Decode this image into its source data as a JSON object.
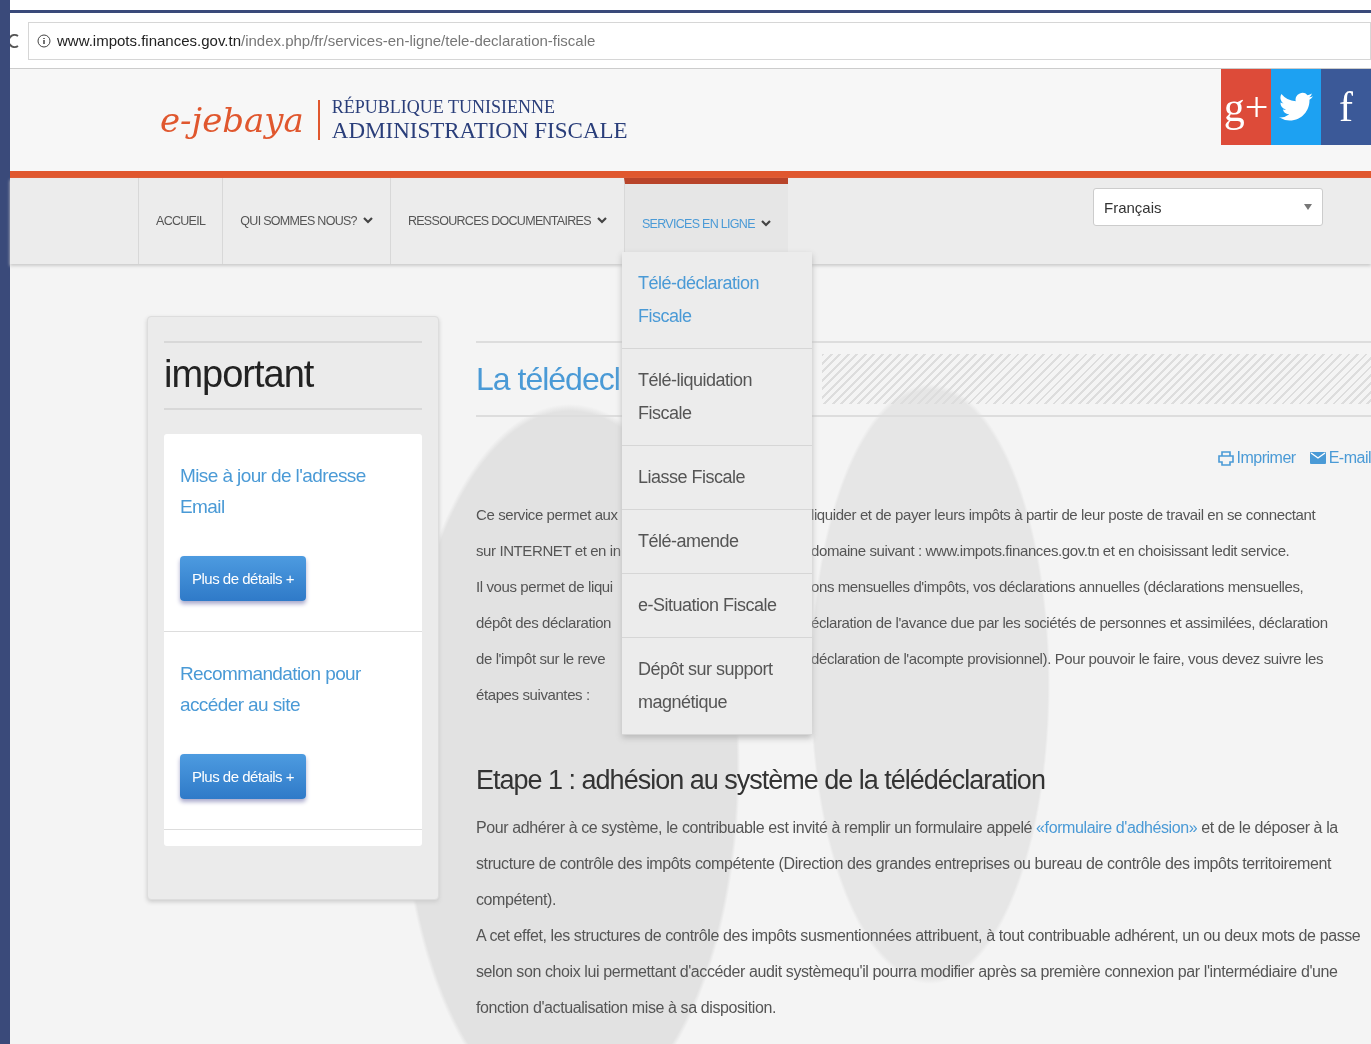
{
  "browser": {
    "url_host": "www.impots.finances.gov.tn",
    "url_path": "/index.php/fr/services-en-ligne/tele-declaration-fiscale"
  },
  "header": {
    "logo_text": "e-jebaya",
    "title_line1": "RÉPUBLIQUE TUNISIENNE",
    "title_line2": "ADMINISTRATION FISCALE"
  },
  "social": [
    {
      "kind": "gplus",
      "glyph": "g+"
    },
    {
      "kind": "twitter"
    },
    {
      "kind": "facebook",
      "glyph": "f"
    }
  ],
  "nav": [
    {
      "label": "ACCUEIL",
      "has_caret": false,
      "selected": false
    },
    {
      "label": "QUI SOMMES NOUS?",
      "has_caret": true,
      "selected": false
    },
    {
      "label": "RESSOURCES DOCUMENTAIRES",
      "has_caret": true,
      "selected": false
    },
    {
      "label": "SERVICES EN LIGNE",
      "has_caret": true,
      "selected": true
    }
  ],
  "language": {
    "value": "Français"
  },
  "dropdown": [
    {
      "label": "Télé-déclaration Fiscale",
      "selected": true
    },
    {
      "label": "Télé-liquidation Fiscale",
      "selected": false
    },
    {
      "label": "Liasse Fiscale",
      "selected": false
    },
    {
      "label": "Télé-amende",
      "selected": false
    },
    {
      "label": "e-Situation Fiscale",
      "selected": false
    },
    {
      "label": "Dépôt sur support magnétique",
      "selected": false
    }
  ],
  "sidebar": {
    "title": "important",
    "cards": [
      {
        "title": "Mise à jour de l'adresse Email",
        "button": "Plus de détails +"
      },
      {
        "title": "Recommandation pour accéder au site",
        "button": "Plus de détails +"
      }
    ]
  },
  "main": {
    "title": "La télédecl",
    "actions": [
      {
        "kind": "print",
        "label": "Imprimer"
      },
      {
        "kind": "email",
        "label": "E-mail"
      }
    ],
    "intro_lines": [
      {
        "left": "Ce service permet aux",
        "right": "liquider et de payer leurs impôts à partir de leur poste de travail en se connectant"
      },
      {
        "left": "sur INTERNET et en in",
        "right": "domaine suivant : www.impots.finances.gov.tn et en choisissant ledit service."
      },
      {
        "left": "Il vous permet de liqui",
        "right": "ons mensuelles d'impôts, vos déclarations annuelles (déclarations mensuelles,"
      },
      {
        "left": "dépôt des déclaration",
        "right": "éclaration de l'avance due par les sociétés de personnes et assimilées, déclaration"
      },
      {
        "left": "de l'impôt sur le reve",
        "right": "déclaration de l'acompte provisionnel). Pour pouvoir le faire, vous devez suivre les"
      },
      {
        "left": "étapes suivantes :"
      }
    ],
    "step_heading": "Etape 1 : adhésion au système de la télédéclaration",
    "step_para1": {
      "before": "Pour adhérer à ce système, le contribuable est invité à remplir un formulaire appelé ",
      "link": "«formulaire d'adhésion»",
      "after": " et de le déposer à la structure de contrôle des impôts compétente (Direction des grandes entreprises ou bureau de contrôle des impôts territoirement compétent)."
    },
    "step_para2": "A cet effet, les structures de contrôle des impôts susmentionnées attribuent, à tout contribuable adhérent, un ou deux mots de passe selon son choix lui permettant d'accéder audit systèmequ'il pourra modifier après sa première connexion par l'intermédiaire d'une fonction d'actualisation mise à sa disposition."
  }
}
